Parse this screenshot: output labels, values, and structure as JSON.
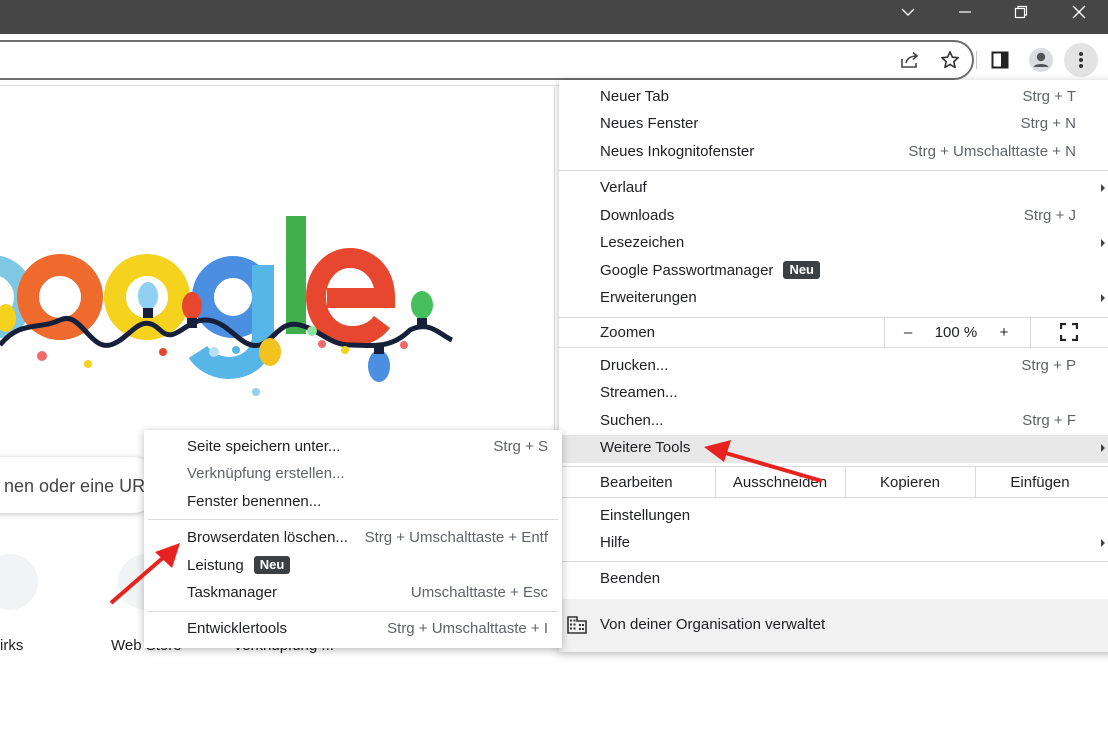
{
  "window_controls": {
    "tabsearch_icon": "chevron-down",
    "minimize_icon": "minimize",
    "restore_icon": "restore",
    "close_icon": "close"
  },
  "toolbar": {
    "icons": [
      "share-icon",
      "bookmark-star-icon",
      "side-panel-icon",
      "profile-icon",
      "chrome-menu-icon"
    ]
  },
  "page": {
    "search_placeholder": "nen oder eine UR",
    "shortcuts": [
      {
        "label": "irks"
      },
      {
        "label": "Web Store"
      },
      {
        "label": "Verknüpfung ..."
      }
    ]
  },
  "menu": {
    "group1": [
      {
        "label": "Neuer Tab",
        "shortcut": "Strg + T"
      },
      {
        "label": "Neues Fenster",
        "shortcut": "Strg + N"
      },
      {
        "label": "Neues Inkognitofenster",
        "shortcut": "Strg + Umschalttaste + N"
      }
    ],
    "group2": [
      {
        "label": "Verlauf",
        "shortcut": ""
      },
      {
        "label": "Downloads",
        "shortcut": "Strg + J"
      },
      {
        "label": "Lesezeichen",
        "shortcut": ""
      },
      {
        "label": "Google Passwortmanager",
        "shortcut": "",
        "badge": "Neu"
      },
      {
        "label": "Erweiterungen",
        "shortcut": ""
      }
    ],
    "zoom": {
      "label": "Zoomen",
      "minus": "–",
      "value": "100 %",
      "plus": "+"
    },
    "group3": [
      {
        "label": "Drucken...",
        "shortcut": "Strg + P"
      },
      {
        "label": "Streamen...",
        "shortcut": ""
      },
      {
        "label": "Suchen...",
        "shortcut": "Strg + F"
      },
      {
        "label": "Weitere Tools",
        "shortcut": ""
      }
    ],
    "edit": {
      "label": "Bearbeiten",
      "cut": "Ausschneiden",
      "copy": "Kopieren",
      "paste": "Einfügen"
    },
    "group4": [
      {
        "label": "Einstellungen"
      },
      {
        "label": "Hilfe"
      }
    ],
    "exit": "Beenden",
    "managed": "Von deiner Organisation verwaltet"
  },
  "submenu": {
    "items": [
      {
        "label": "Seite speichern unter...",
        "shortcut": "Strg + S"
      },
      {
        "label": "Verknüpfung erstellen...",
        "shortcut": ""
      },
      {
        "label": "Fenster benennen...",
        "shortcut": ""
      },
      {
        "label": "Browserdaten löschen...",
        "shortcut": "Strg + Umschalttaste + Entf"
      },
      {
        "label": "Leistung",
        "shortcut": "",
        "badge": "Neu"
      },
      {
        "label": "Taskmanager",
        "shortcut": "Umschalttaste + Esc"
      },
      {
        "label": "Entwicklertools",
        "shortcut": "Strg + Umschalttaste + I"
      }
    ]
  },
  "colors": {
    "titlebar": "#474646",
    "highlight": "#e8e8e8",
    "arrow": "#e8231f",
    "badge": "#3c4043"
  }
}
